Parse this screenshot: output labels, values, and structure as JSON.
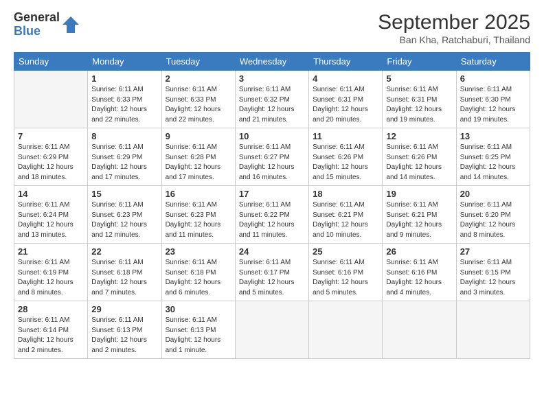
{
  "header": {
    "logo_general": "General",
    "logo_blue": "Blue",
    "month_title": "September 2025",
    "subtitle": "Ban Kha, Ratchaburi, Thailand"
  },
  "days_of_week": [
    "Sunday",
    "Monday",
    "Tuesday",
    "Wednesday",
    "Thursday",
    "Friday",
    "Saturday"
  ],
  "weeks": [
    [
      {
        "day": "",
        "info": ""
      },
      {
        "day": "1",
        "info": "Sunrise: 6:11 AM\nSunset: 6:33 PM\nDaylight: 12 hours\nand 22 minutes."
      },
      {
        "day": "2",
        "info": "Sunrise: 6:11 AM\nSunset: 6:33 PM\nDaylight: 12 hours\nand 22 minutes."
      },
      {
        "day": "3",
        "info": "Sunrise: 6:11 AM\nSunset: 6:32 PM\nDaylight: 12 hours\nand 21 minutes."
      },
      {
        "day": "4",
        "info": "Sunrise: 6:11 AM\nSunset: 6:31 PM\nDaylight: 12 hours\nand 20 minutes."
      },
      {
        "day": "5",
        "info": "Sunrise: 6:11 AM\nSunset: 6:31 PM\nDaylight: 12 hours\nand 19 minutes."
      },
      {
        "day": "6",
        "info": "Sunrise: 6:11 AM\nSunset: 6:30 PM\nDaylight: 12 hours\nand 19 minutes."
      }
    ],
    [
      {
        "day": "7",
        "info": "Sunrise: 6:11 AM\nSunset: 6:29 PM\nDaylight: 12 hours\nand 18 minutes."
      },
      {
        "day": "8",
        "info": "Sunrise: 6:11 AM\nSunset: 6:29 PM\nDaylight: 12 hours\nand 17 minutes."
      },
      {
        "day": "9",
        "info": "Sunrise: 6:11 AM\nSunset: 6:28 PM\nDaylight: 12 hours\nand 17 minutes."
      },
      {
        "day": "10",
        "info": "Sunrise: 6:11 AM\nSunset: 6:27 PM\nDaylight: 12 hours\nand 16 minutes."
      },
      {
        "day": "11",
        "info": "Sunrise: 6:11 AM\nSunset: 6:26 PM\nDaylight: 12 hours\nand 15 minutes."
      },
      {
        "day": "12",
        "info": "Sunrise: 6:11 AM\nSunset: 6:26 PM\nDaylight: 12 hours\nand 14 minutes."
      },
      {
        "day": "13",
        "info": "Sunrise: 6:11 AM\nSunset: 6:25 PM\nDaylight: 12 hours\nand 14 minutes."
      }
    ],
    [
      {
        "day": "14",
        "info": "Sunrise: 6:11 AM\nSunset: 6:24 PM\nDaylight: 12 hours\nand 13 minutes."
      },
      {
        "day": "15",
        "info": "Sunrise: 6:11 AM\nSunset: 6:23 PM\nDaylight: 12 hours\nand 12 minutes."
      },
      {
        "day": "16",
        "info": "Sunrise: 6:11 AM\nSunset: 6:23 PM\nDaylight: 12 hours\nand 11 minutes."
      },
      {
        "day": "17",
        "info": "Sunrise: 6:11 AM\nSunset: 6:22 PM\nDaylight: 12 hours\nand 11 minutes."
      },
      {
        "day": "18",
        "info": "Sunrise: 6:11 AM\nSunset: 6:21 PM\nDaylight: 12 hours\nand 10 minutes."
      },
      {
        "day": "19",
        "info": "Sunrise: 6:11 AM\nSunset: 6:21 PM\nDaylight: 12 hours\nand 9 minutes."
      },
      {
        "day": "20",
        "info": "Sunrise: 6:11 AM\nSunset: 6:20 PM\nDaylight: 12 hours\nand 8 minutes."
      }
    ],
    [
      {
        "day": "21",
        "info": "Sunrise: 6:11 AM\nSunset: 6:19 PM\nDaylight: 12 hours\nand 8 minutes."
      },
      {
        "day": "22",
        "info": "Sunrise: 6:11 AM\nSunset: 6:18 PM\nDaylight: 12 hours\nand 7 minutes."
      },
      {
        "day": "23",
        "info": "Sunrise: 6:11 AM\nSunset: 6:18 PM\nDaylight: 12 hours\nand 6 minutes."
      },
      {
        "day": "24",
        "info": "Sunrise: 6:11 AM\nSunset: 6:17 PM\nDaylight: 12 hours\nand 5 minutes."
      },
      {
        "day": "25",
        "info": "Sunrise: 6:11 AM\nSunset: 6:16 PM\nDaylight: 12 hours\nand 5 minutes."
      },
      {
        "day": "26",
        "info": "Sunrise: 6:11 AM\nSunset: 6:16 PM\nDaylight: 12 hours\nand 4 minutes."
      },
      {
        "day": "27",
        "info": "Sunrise: 6:11 AM\nSunset: 6:15 PM\nDaylight: 12 hours\nand 3 minutes."
      }
    ],
    [
      {
        "day": "28",
        "info": "Sunrise: 6:11 AM\nSunset: 6:14 PM\nDaylight: 12 hours\nand 2 minutes."
      },
      {
        "day": "29",
        "info": "Sunrise: 6:11 AM\nSunset: 6:13 PM\nDaylight: 12 hours\nand 2 minutes."
      },
      {
        "day": "30",
        "info": "Sunrise: 6:11 AM\nSunset: 6:13 PM\nDaylight: 12 hours\nand 1 minute."
      },
      {
        "day": "",
        "info": ""
      },
      {
        "day": "",
        "info": ""
      },
      {
        "day": "",
        "info": ""
      },
      {
        "day": "",
        "info": ""
      }
    ]
  ]
}
